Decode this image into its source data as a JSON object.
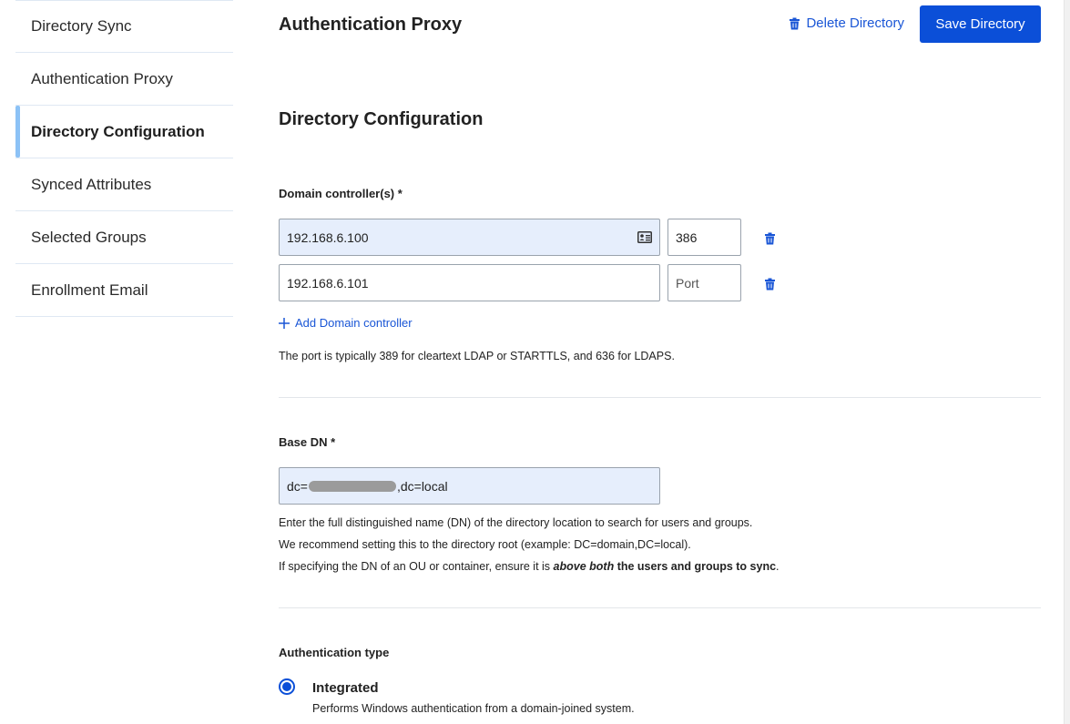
{
  "sidebar": {
    "items": [
      {
        "label": "Directory Sync"
      },
      {
        "label": "Authentication Proxy"
      },
      {
        "label": "Directory Configuration"
      },
      {
        "label": "Synced Attributes"
      },
      {
        "label": "Selected Groups"
      },
      {
        "label": "Enrollment Email"
      }
    ],
    "active": "Directory Configuration"
  },
  "header": {
    "title": "Authentication Proxy",
    "delete_label": "Delete Directory",
    "save_label": "Save Directory"
  },
  "section": {
    "title": "Directory Configuration"
  },
  "domain_controllers": {
    "label": "Domain controller(s) *",
    "rows": [
      {
        "host": "192.168.6.100",
        "port": "386",
        "port_placeholder": "Port"
      },
      {
        "host": "192.168.6.101",
        "port": "",
        "port_placeholder": "Port"
      }
    ],
    "add_label": "Add Domain controller",
    "help": "The port is typically 389 for cleartext LDAP or STARTTLS, and 636 for LDAPS."
  },
  "base_dn": {
    "label": "Base DN *",
    "value_prefix": "dc=",
    "value_suffix": ",dc=local",
    "help_line1": "Enter the full distinguished name (DN) of the directory location to search for users and groups.",
    "help_line2": "We recommend setting this to the directory root (example: DC=domain,DC=local).",
    "help_line3_a": "If specifying the DN of an OU or container, ensure it is ",
    "help_line3_b": "above both",
    "help_line3_c": " the users and groups to sync",
    "help_line3_d": "."
  },
  "auth_type": {
    "label": "Authentication type",
    "option_label": "Integrated",
    "option_desc": "Performs Windows authentication from a domain-joined system."
  },
  "colors": {
    "accent": "#0b4fd8",
    "link": "#1a56d6",
    "active_indicator": "#8cc2f6",
    "filled_input": "#e6eefc"
  },
  "icons": {
    "delete": "trash-icon",
    "add": "plus-icon",
    "contact_card": "contact-card-icon"
  }
}
